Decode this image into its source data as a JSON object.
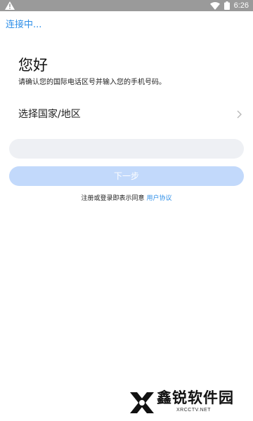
{
  "status_bar": {
    "time": "6:26",
    "warning_icon": "warning-triangle-icon",
    "wifi_icon": "wifi-icon",
    "battery_icon": "battery-icon",
    "background_color": "#9a9a9a"
  },
  "header": {
    "connection_status": "连接中..."
  },
  "main": {
    "greeting": "您好",
    "hint": "请确认您的国际电话区号并输入您的手机号码。",
    "country_select_label": "选择国家/地区",
    "country_chevron_icon": "chevron-right-icon",
    "phone_input_value": "",
    "phone_input_placeholder": "",
    "next_button_label": "下一步",
    "agreement_text": "注册或登录即表示同意",
    "agreement_link": "用户协议"
  },
  "watermark": {
    "title": "鑫锐软件园",
    "subtitle": "XRCCTV.NET"
  },
  "colors": {
    "accent": "#2f8fe8",
    "button_disabled": "#c2d9fb",
    "input_background": "#eef0f4"
  }
}
